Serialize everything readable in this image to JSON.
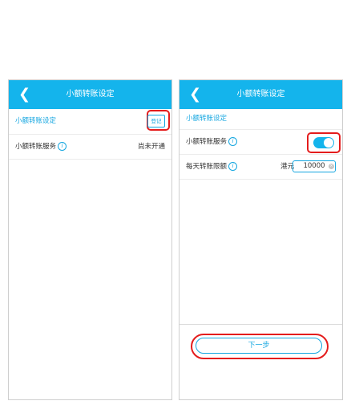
{
  "left": {
    "header": {
      "back": "❮",
      "title": "小额转账设定"
    },
    "section_title": "小额转账设定",
    "register_button": "登记",
    "service_row": {
      "label": "小额转账服务",
      "info": "i",
      "status": "尚未开通"
    }
  },
  "right": {
    "header": {
      "back": "❮",
      "title": "小额转账设定"
    },
    "section_title": "小额转账设定",
    "service_row": {
      "label": "小额转账服务",
      "info": "i",
      "toggle_on": true
    },
    "limit_row": {
      "label": "每天转账限额",
      "info": "i",
      "currency": "港元",
      "amount": "10000",
      "clear": "×"
    },
    "next_button": "下一步"
  },
  "colors": {
    "accent": "#14b4ec",
    "highlight": "#e41c1c"
  }
}
